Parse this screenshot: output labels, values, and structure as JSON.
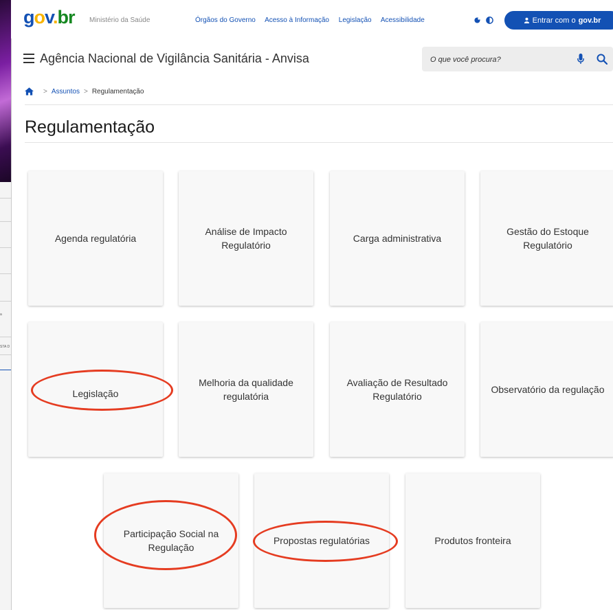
{
  "background_window": {
    "tiny_texts": [
      "a",
      "STA D"
    ]
  },
  "header": {
    "logo": {
      "g": "g",
      "o": "o",
      "v": "v",
      "dot": ".",
      "br": "br"
    },
    "ministry": "Ministério da Saúde",
    "links": [
      "Órgãos do Governo",
      "Acesso à Informação",
      "Legislação",
      "Acessibilidade"
    ],
    "login": {
      "prefix": "Entrar com o",
      "brand": "gov.br"
    },
    "colors": {
      "primary": "#1351b4",
      "logo_yellow": "#f8b400",
      "logo_green": "#168821"
    }
  },
  "nav": {
    "site_title": "Agência Nacional de Vigilância Sanitária - Anvisa",
    "search_placeholder": "O que você procura?"
  },
  "breadcrumb": {
    "items": [
      "Assuntos",
      "Regulamentação"
    ],
    "separator": ">"
  },
  "page": {
    "title": "Regulamentação"
  },
  "cards": [
    {
      "label": "Agenda regulatória",
      "highlighted": false
    },
    {
      "label": "Análise de Impacto Regulatório",
      "highlighted": false
    },
    {
      "label": "Carga administrativa",
      "highlighted": false
    },
    {
      "label": "Gestão do Estoque Regulatório",
      "highlighted": false
    },
    {
      "label": "Legislação",
      "highlighted": true
    },
    {
      "label": "Melhoria da qualidade regulatória",
      "highlighted": false
    },
    {
      "label": "Avaliação de Resultado Regulatório",
      "highlighted": false
    },
    {
      "label": "Observatório da regulação",
      "highlighted": false
    },
    {
      "label": "Participação Social na Regulação",
      "highlighted": true
    },
    {
      "label": "Propostas regulatórias",
      "highlighted": true
    },
    {
      "label": "Produtos fronteira",
      "highlighted": false
    }
  ],
  "annotation_color": "#e53c21"
}
